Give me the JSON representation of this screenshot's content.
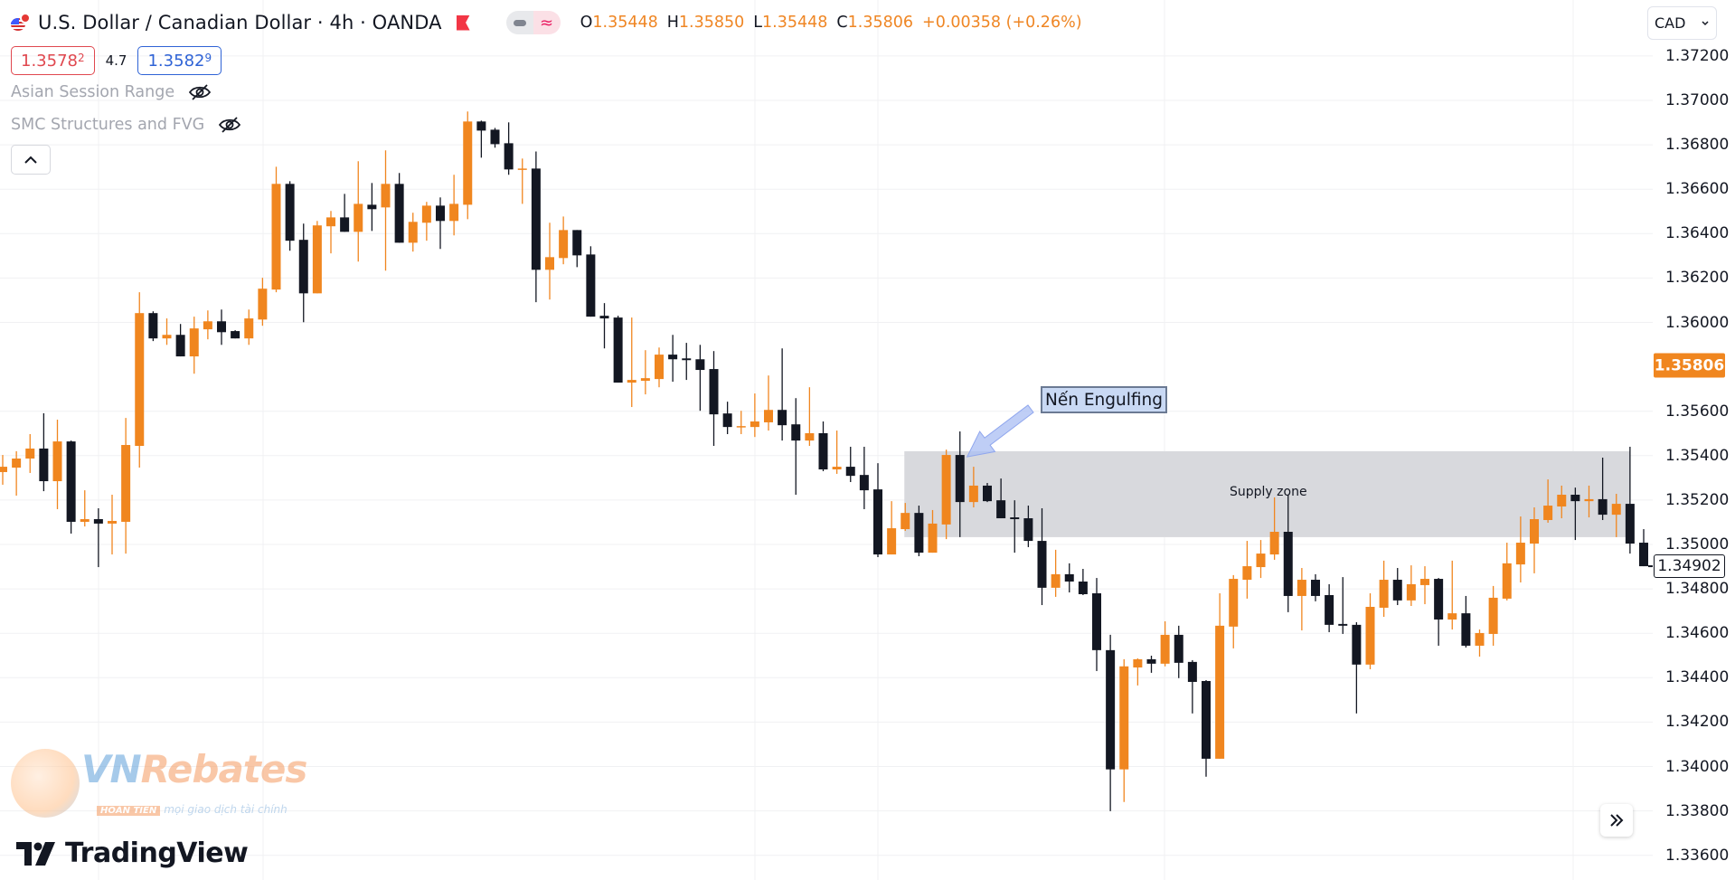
{
  "header": {
    "symbol_title": "U.S. Dollar / Canadian Dollar · 4h · OANDA",
    "ohlc": [
      {
        "key": "O",
        "value": "1.35448"
      },
      {
        "key": "H",
        "value": "1.35850"
      },
      {
        "key": "L",
        "value": "1.35448"
      },
      {
        "key": "C",
        "value": "1.35806"
      }
    ],
    "change": "+0.00358 (+0.26%)",
    "sell_price_main": "1.3578",
    "sell_price_sup": "2",
    "spread": "4.7",
    "buy_price_main": "1.3582",
    "buy_price_sup": "9",
    "approx_symbol": "≈"
  },
  "indicators": [
    {
      "name": "Asian Session Range",
      "visible": false
    },
    {
      "name": "SMC Structures and FVG",
      "visible": false
    }
  ],
  "price_axis": {
    "currency": "CAD",
    "current_price_label": "1.35806",
    "crosshair_price_label": "1.34902"
  },
  "annotations": {
    "callout_text": "Nến Engulfing",
    "zone_text": "Supply zone"
  },
  "watermarks": {
    "vn_brand_a": "VN",
    "vn_brand_b": "Rebates",
    "vn_badge": "HOÀN TIỀN",
    "vn_tagline": "mọi giao dịch tài chính",
    "tradingview": "TradingView"
  },
  "colors": {
    "up": "#f0861f",
    "down": "#131722",
    "zone": "#d8d9dd",
    "grid": "#f0f1f3",
    "callout_bg": "#c9d9f4",
    "arrow": "#a9bdf3"
  },
  "chart_data": {
    "type": "candlestick",
    "title": "U.S. Dollar / Canadian Dollar · 4h · OANDA",
    "xlabel": "",
    "ylabel": "CAD",
    "ylim": [
      1.3352,
      1.374
    ],
    "y_ticks": [
      "1.37200",
      "1.37000",
      "1.36800",
      "1.36600",
      "1.36400",
      "1.36200",
      "1.36000",
      "1.35600",
      "1.35400",
      "1.35200",
      "1.35000",
      "1.34800",
      "1.34600",
      "1.34400",
      "1.34200",
      "1.34000",
      "1.33800",
      "1.33600"
    ],
    "grid": true,
    "supply_zone": {
      "from_index": 66,
      "to_index": 119,
      "top": 1.3542,
      "bottom": 1.35033,
      "label": "Supply zone"
    },
    "callout": {
      "text": "Nến Engulfing",
      "points_to_index": 70,
      "price": 1.35403
    },
    "last_close": 1.34902,
    "current_price": 1.35806,
    "candles": [
      [
        1.35326,
        1.35403,
        1.35269,
        1.3535
      ],
      [
        1.35346,
        1.3542,
        1.3522,
        1.35387
      ],
      [
        1.35387,
        1.35497,
        1.35322,
        1.35432
      ],
      [
        1.35432,
        1.35591,
        1.3524,
        1.35285
      ],
      [
        1.35285,
        1.35562,
        1.35159,
        1.35464
      ],
      [
        1.35464,
        1.35468,
        1.35049,
        1.35102
      ],
      [
        1.35102,
        1.35244,
        1.35081,
        1.35114
      ],
      [
        1.35114,
        1.35163,
        1.34898,
        1.35094
      ],
      [
        1.35094,
        1.35224,
        1.34955,
        1.35106
      ],
      [
        1.35102,
        1.3557,
        1.34959,
        1.35448
      ],
      [
        1.35444,
        1.36136,
        1.35346,
        1.36042
      ],
      [
        1.36042,
        1.3605,
        1.35916,
        1.35928
      ],
      [
        1.35928,
        1.36018,
        1.35899,
        1.35944
      ],
      [
        1.35944,
        1.35993,
        1.35847,
        1.35847
      ],
      [
        1.35847,
        1.36026,
        1.35769,
        1.35973
      ],
      [
        1.35969,
        1.36054,
        1.35924,
        1.36005
      ],
      [
        1.36005,
        1.36058,
        1.35899,
        1.35956
      ],
      [
        1.35961,
        1.35965,
        1.35928,
        1.35928
      ],
      [
        1.35928,
        1.36058,
        1.35899,
        1.36018
      ],
      [
        1.36013,
        1.36201,
        1.35985,
        1.36152
      ],
      [
        1.36148,
        1.36701,
        1.36136,
        1.36624
      ],
      [
        1.36624,
        1.36636,
        1.36323,
        1.36368
      ],
      [
        1.36372,
        1.36445,
        1.36001,
        1.36131
      ],
      [
        1.36131,
        1.36457,
        1.36131,
        1.36437
      ],
      [
        1.36433,
        1.36502,
        1.36311,
        1.36473
      ],
      [
        1.36473,
        1.36579,
        1.36408,
        1.36408
      ],
      [
        1.36408,
        1.36726,
        1.36274,
        1.36534
      ],
      [
        1.3653,
        1.36628,
        1.36412,
        1.3651
      ],
      [
        1.36518,
        1.36775,
        1.36233,
        1.36624
      ],
      [
        1.36624,
        1.36673,
        1.36359,
        1.36359
      ],
      [
        1.36359,
        1.36494,
        1.36319,
        1.36453
      ],
      [
        1.36449,
        1.36543,
        1.36368,
        1.36526
      ],
      [
        1.36526,
        1.36563,
        1.36331,
        1.36457
      ],
      [
        1.36457,
        1.36665,
        1.36392,
        1.36534
      ],
      [
        1.3653,
        1.3695,
        1.36465,
        1.36905
      ],
      [
        1.36905,
        1.36909,
        1.36742,
        1.36864
      ],
      [
        1.36868,
        1.36876,
        1.36787,
        1.36803
      ],
      [
        1.36807,
        1.36901,
        1.36665,
        1.36689
      ],
      [
        1.36689,
        1.36738,
        1.36534,
        1.36693
      ],
      [
        1.36693,
        1.3677,
        1.36091,
        1.36237
      ],
      [
        1.36237,
        1.36449,
        1.36103,
        1.36294
      ],
      [
        1.3629,
        1.36477,
        1.36262,
        1.36416
      ],
      [
        1.36416,
        1.36416,
        1.36249,
        1.36302
      ],
      [
        1.36306,
        1.36343,
        1.36026,
        1.36026
      ],
      [
        1.3603,
        1.36087,
        1.35883,
        1.36018
      ],
      [
        1.36022,
        1.3603,
        1.35729,
        1.35729
      ],
      [
        1.35729,
        1.36022,
        1.35619,
        1.35741
      ],
      [
        1.35737,
        1.35875,
        1.35676,
        1.35749
      ],
      [
        1.35745,
        1.35887,
        1.35708,
        1.35855
      ],
      [
        1.35855,
        1.35944,
        1.35733,
        1.35834
      ],
      [
        1.35838,
        1.35908,
        1.35741,
        1.3583
      ],
      [
        1.35834,
        1.35899,
        1.35602,
        1.35786
      ],
      [
        1.3579,
        1.35871,
        1.35444,
        1.35586
      ],
      [
        1.3559,
        1.35643,
        1.35497,
        1.35529
      ],
      [
        1.35529,
        1.35602,
        1.35497,
        1.35533
      ],
      [
        1.35529,
        1.3568,
        1.35484,
        1.35554
      ],
      [
        1.3555,
        1.35761,
        1.35513,
        1.35606
      ],
      [
        1.35606,
        1.35883,
        1.35468,
        1.35537
      ],
      [
        1.35541,
        1.35659,
        1.35224,
        1.35468
      ],
      [
        1.35468,
        1.35708,
        1.35444,
        1.35501
      ],
      [
        1.35501,
        1.35554,
        1.3533,
        1.35338
      ],
      [
        1.35338,
        1.35513,
        1.35318,
        1.3535
      ],
      [
        1.3535,
        1.3544,
        1.35281,
        1.35309
      ],
      [
        1.35313,
        1.3544,
        1.35159,
        1.35244
      ],
      [
        1.35248,
        1.35366,
        1.34943,
        1.34955
      ],
      [
        1.34955,
        1.35195,
        1.34955,
        1.35073
      ],
      [
        1.35069,
        1.35187,
        1.35061,
        1.35142
      ],
      [
        1.35142,
        1.35175,
        1.34947,
        1.34963
      ],
      [
        1.34963,
        1.35155,
        1.34963,
        1.35094
      ],
      [
        1.3509,
        1.35427,
        1.35024,
        1.35403
      ],
      [
        1.35403,
        1.35509,
        1.35033,
        1.35191
      ],
      [
        1.35191,
        1.3535,
        1.35167,
        1.35265
      ],
      [
        1.35265,
        1.35277,
        1.35191,
        1.35195
      ],
      [
        1.35199,
        1.35297,
        1.35118,
        1.35118
      ],
      [
        1.35122,
        1.35199,
        1.34963,
        1.35114
      ],
      [
        1.35118,
        1.35175,
        1.34988,
        1.35016
      ],
      [
        1.35016,
        1.35163,
        1.34727,
        1.34805
      ],
      [
        1.34805,
        1.34976,
        1.34764,
        1.34866
      ],
      [
        1.34866,
        1.34915,
        1.34784,
        1.34833
      ],
      [
        1.34833,
        1.3489,
        1.34772,
        1.34776
      ],
      [
        1.3478,
        1.34849,
        1.3443,
        1.34524
      ],
      [
        1.34524,
        1.34593,
        1.33799,
        1.33987
      ],
      [
        1.33987,
        1.34483,
        1.3384,
        1.34451
      ],
      [
        1.34446,
        1.34487,
        1.34365,
        1.34483
      ],
      [
        1.34483,
        1.34499,
        1.34422,
        1.34463
      ],
      [
        1.34463,
        1.34654,
        1.34451,
        1.34593
      ],
      [
        1.34593,
        1.34634,
        1.34398,
        1.34467
      ],
      [
        1.34471,
        1.34479,
        1.34239,
        1.34381
      ],
      [
        1.34385,
        1.34389,
        1.33954,
        1.34035
      ],
      [
        1.34035,
        1.3478,
        1.34035,
        1.34634
      ],
      [
        1.3463,
        1.34862,
        1.34532,
        1.34845
      ],
      [
        1.34841,
        1.35016,
        1.34756,
        1.34902
      ],
      [
        1.34898,
        1.3502,
        1.34849,
        1.34959
      ],
      [
        1.34955,
        1.35212,
        1.34931,
        1.35057
      ],
      [
        1.35057,
        1.35224,
        1.34695,
        1.34768
      ],
      [
        1.34768,
        1.34894,
        1.34613,
        1.34841
      ],
      [
        1.34841,
        1.34866,
        1.34744,
        1.34768
      ],
      [
        1.34772,
        1.34821,
        1.34605,
        1.34638
      ],
      [
        1.34642,
        1.34853,
        1.34597,
        1.34634
      ],
      [
        1.34638,
        1.3465,
        1.34239,
        1.34459
      ],
      [
        1.34459,
        1.3478,
        1.34438,
        1.34719
      ],
      [
        1.34715,
        1.34927,
        1.34674,
        1.34841
      ],
      [
        1.34841,
        1.34894,
        1.34727,
        1.34748
      ],
      [
        1.34748,
        1.34906,
        1.34723,
        1.34821
      ],
      [
        1.34817,
        1.34902,
        1.34731,
        1.34845
      ],
      [
        1.34845,
        1.34849,
        1.34544,
        1.34662
      ],
      [
        1.34662,
        1.34927,
        1.34617,
        1.3469
      ],
      [
        1.3469,
        1.34768,
        1.34536,
        1.34544
      ],
      [
        1.34544,
        1.34617,
        1.34495,
        1.34601
      ],
      [
        1.34597,
        1.34813,
        1.34544,
        1.3476
      ],
      [
        1.34756,
        1.35008,
        1.34748,
        1.34915
      ],
      [
        1.3491,
        1.35126,
        1.34829,
        1.35008
      ],
      [
        1.35004,
        1.35167,
        1.3487,
        1.35114
      ],
      [
        1.3511,
        1.35293,
        1.35098,
        1.35175
      ],
      [
        1.35171,
        1.35265,
        1.35118,
        1.35224
      ],
      [
        1.35224,
        1.35256,
        1.3502,
        1.35195
      ],
      [
        1.35195,
        1.35265,
        1.35122,
        1.35204
      ],
      [
        1.35204,
        1.35391,
        1.3511,
        1.35134
      ],
      [
        1.35134,
        1.35228,
        1.35033,
        1.35183
      ],
      [
        1.35183,
        1.3544,
        1.34959,
        1.35004
      ],
      [
        1.35008,
        1.35069,
        1.34902,
        1.34902
      ]
    ]
  }
}
